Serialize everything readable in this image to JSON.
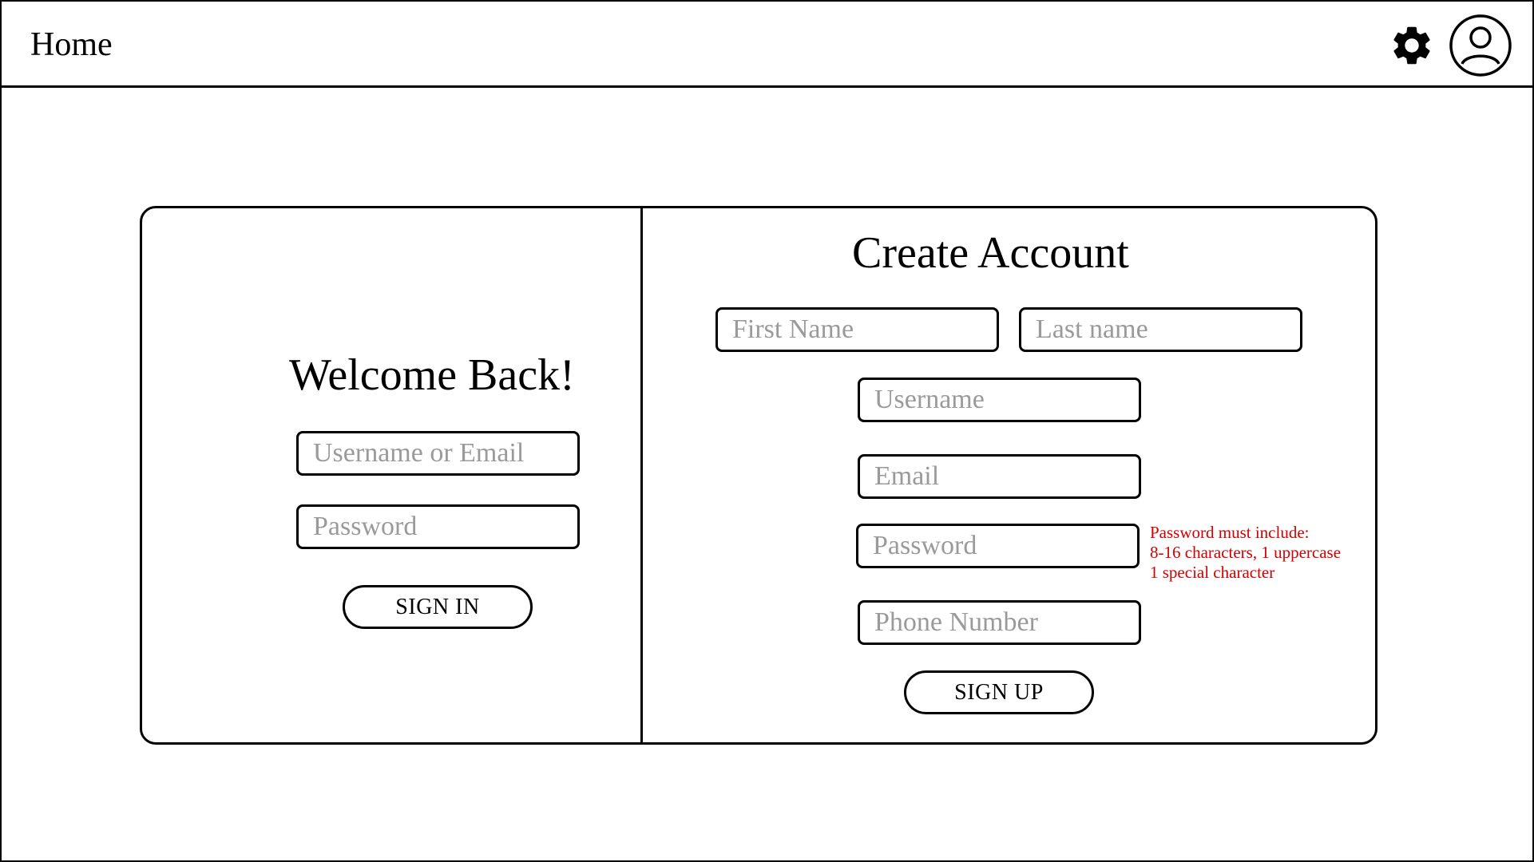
{
  "header": {
    "home_label": "Home",
    "settings_icon": "gear-icon",
    "profile_icon": "user-circle-icon"
  },
  "sign_in": {
    "title": "Welcome Back!",
    "username_placeholder": "Username or Email",
    "password_placeholder": "Password",
    "button_label": "SIGN IN"
  },
  "sign_up": {
    "title": "Create Account",
    "first_name_placeholder": "First Name",
    "last_name_placeholder": "Last name",
    "username_placeholder": "Username",
    "email_placeholder": "Email",
    "password_placeholder": "Password",
    "phone_placeholder": "Phone Number",
    "password_hint": {
      "line1": "Password must include:",
      "line2": "8-16 characters, 1 uppercase",
      "line3": "1 special character"
    },
    "button_label": "SIGN UP"
  },
  "colors": {
    "hint": "#d40000",
    "placeholder": "#9a9a9a",
    "border": "#000000"
  }
}
